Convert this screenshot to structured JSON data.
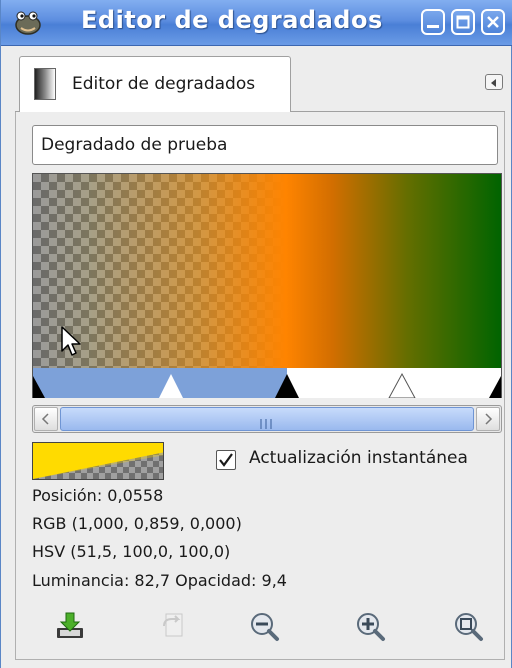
{
  "window": {
    "title": "Editor de degradados"
  },
  "tab": {
    "label": "Editor de degradados"
  },
  "gradient": {
    "name": "Degradado de prueba"
  },
  "instant_update": {
    "label": "Actualización instantánea",
    "checked": true
  },
  "info": {
    "position": "Posición: 0,0558",
    "rgb": "RGB (1,000, 0,859, 0,000)",
    "hsv": "HSV (51,5, 100,0, 100,0)",
    "luminance_opacity": "Luminancia: 82,7  Opacidad: 9,4"
  },
  "colors": {
    "titlebar": "#5d8ee0",
    "swatch_color": "#ffdb00",
    "gradient_mid": "#ff8400",
    "gradient_end": "#006400",
    "selection": "#7da1d9"
  },
  "icons": {
    "app": "gimp-wilber-icon",
    "minimize": "minimize-icon",
    "maximize": "maximize-icon",
    "close": "close-icon",
    "tab_gradient": "gradient-icon",
    "tab_menu": "tab-menu-icon",
    "tools": [
      "save-icon",
      "revert-icon",
      "zoom-out-icon",
      "zoom-in-icon",
      "zoom-fit-icon"
    ]
  }
}
